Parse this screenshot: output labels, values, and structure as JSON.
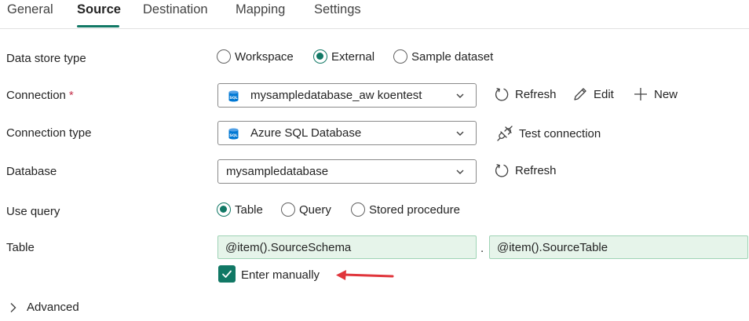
{
  "tabs": [
    {
      "label": "General"
    },
    {
      "label": "Source",
      "active": true
    },
    {
      "label": "Destination"
    },
    {
      "label": "Mapping"
    },
    {
      "label": "Settings"
    }
  ],
  "data_store_type": {
    "label": "Data store type",
    "options": [
      "Workspace",
      "External",
      "Sample dataset"
    ],
    "selected": "External"
  },
  "connection": {
    "label": "Connection",
    "required_mark": "*",
    "value": "mysampledatabase_aw koentest",
    "icon": "sql-database-icon",
    "refresh_label": "Refresh",
    "edit_label": "Edit",
    "new_label": "New"
  },
  "connection_type": {
    "label": "Connection type",
    "value": "Azure SQL Database",
    "icon": "sql-database-icon",
    "test_label": "Test connection"
  },
  "database": {
    "label": "Database",
    "value": "mysampledatabase",
    "refresh_label": "Refresh"
  },
  "use_query": {
    "label": "Use query",
    "options": [
      "Table",
      "Query",
      "Stored procedure"
    ],
    "selected": "Table"
  },
  "table": {
    "label": "Table",
    "schema_value": "@item().SourceSchema",
    "separator": ".",
    "table_value": "@item().SourceTable",
    "enter_manually_label": "Enter manually",
    "enter_manually_checked": true
  },
  "advanced": {
    "label": "Advanced"
  },
  "colors": {
    "accent": "#117865",
    "expression_bg": "#e6f4ea",
    "annotation_arrow": "#e0353b",
    "sql_icon": "#0078d4"
  }
}
